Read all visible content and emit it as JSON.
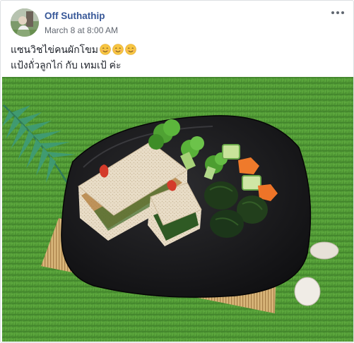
{
  "post": {
    "author": "Off Suthathip",
    "timestamp": "March 8 at 8:00 AM",
    "caption_line1": "แซนวิชไข่คนผักโขม",
    "caption_line2": "แป้งถั่วลูกไก่ กับ เทมเป้ ค่ะ",
    "caption_emojis": [
      "smiling-face-emoji",
      "smiling-face-emoji",
      "smiling-face-emoji"
    ]
  },
  "icons": {
    "more_options": "three-dots-horizontal"
  },
  "colors": {
    "author_link": "#385898",
    "timestamp_text": "#616770",
    "body_text": "#1d2129",
    "grass": "#4f9a34",
    "plate": "#1c1c1e",
    "emoji_face": "#f7c542"
  },
  "photo": {
    "subject": "sandwich-plate-photo"
  }
}
